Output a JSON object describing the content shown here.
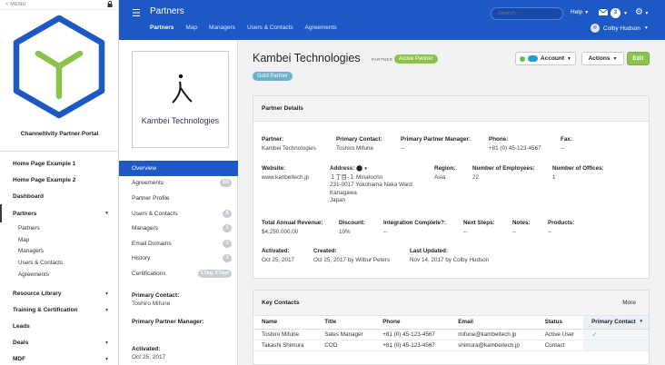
{
  "sidebar": {
    "menu_label": "MENU",
    "portal_name": "Channeltivity Partner Portal",
    "nav": [
      {
        "label": "Home Page Example 1"
      },
      {
        "label": "Home Page Example 2"
      },
      {
        "label": "Dashboard"
      },
      {
        "label": "Partners",
        "sub": [
          "Partners",
          "Map",
          "Managers",
          "Users & Contacts",
          "Agreements"
        ]
      },
      {
        "label": "Resource Library"
      },
      {
        "label": "Training & Certification"
      },
      {
        "label": "Leads"
      },
      {
        "label": "Deals"
      },
      {
        "label": "MDF"
      }
    ]
  },
  "header": {
    "title": "Partners",
    "tabs": [
      "Partners",
      "Map",
      "Managers",
      "Users & Contacts",
      "Agreements"
    ],
    "search_placeholder": "Search...",
    "help_label": "Help",
    "mail_count": "3",
    "user_name": "Colby Hudson"
  },
  "detail_panel": {
    "logo_text": "Kambei Technologies",
    "subnav": [
      {
        "label": "Overview",
        "count": ""
      },
      {
        "label": "Agreements",
        "count": "3/3"
      },
      {
        "label": "Partner Profile",
        "count": ""
      },
      {
        "label": "Users & Contacts",
        "count": "5"
      },
      {
        "label": "Managers",
        "count": "1"
      },
      {
        "label": "Email Domains",
        "count": "1"
      },
      {
        "label": "History",
        "count": "2"
      },
      {
        "label": "Certifications",
        "count": "1 Org, 3 User"
      }
    ],
    "primary_contact_label": "Primary Contact:",
    "primary_contact_value": "Toshiro Mifune",
    "primary_manager_label": "Primary Partner Manager:",
    "primary_manager_value": "",
    "activated_label": "Activated:",
    "activated_value": "Oct 25, 2017"
  },
  "main": {
    "company_name": "Kambei Technologies",
    "partner_tag": "PARTNER",
    "status_badge": "Active Partner",
    "tier_badge": "Gold Partner",
    "buttons": {
      "account": "Account",
      "actions": "Actions",
      "edit": "Edit"
    },
    "details_title": "Partner Details",
    "details": {
      "partner_label": "Partner:",
      "partner_value": "Kambei Technologies",
      "primary_contact_label": "Primary Contact:",
      "primary_contact_value": "Toshiro Mifune",
      "primary_manager_label": "Primary Partner Manager:",
      "primary_manager_value": "--",
      "phone_label": "Phone:",
      "phone_value": "+81 (0) 45-123-4567",
      "fax_label": "Fax:",
      "fax_value": "--",
      "website_label": "Website:",
      "website_value": "www.kanbeitech.jp",
      "address_label": "Address:",
      "address_lines": [
        "１丁目-１ Minatocho",
        "231-0017 Yokohama Naka Ward",
        "Kanagawa",
        "Japan"
      ],
      "region_label": "Region:",
      "region_value": "Asia",
      "employees_label": "Number of Employees:",
      "employees_value": "22",
      "offices_label": "Number of Offices:",
      "offices_value": "1",
      "revenue_label": "Total Annual Revenue:",
      "revenue_value": "$4,250,000.00",
      "discount_label": "Discount:",
      "discount_value": "10%",
      "integration_label": "Integration Complete?:",
      "integration_value": "--",
      "next_steps_label": "Next Steps:",
      "next_steps_value": "--",
      "notes_label": "Notes:",
      "notes_value": "--",
      "products_label": "Products:",
      "products_value": "--",
      "activated_label": "Activated:",
      "activated_value": "Oct 25, 2017",
      "created_label": "Created:",
      "created_value": "Oct 25, 2017 by Wilbur Peters",
      "updated_label": "Last Updated:",
      "updated_value": "Nov 14, 2017 by Colby Hudson"
    },
    "contacts_title": "Key Contacts",
    "more_label": "More",
    "contacts_columns": [
      "Name",
      "Title",
      "Phone",
      "Email",
      "Status",
      "Primary Contact"
    ],
    "contacts_rows": [
      [
        "Toshiro Mifune",
        "Sales Manager",
        "+81 (0) 45-123-4567",
        "mifune@kambeitech.jp",
        "Active User",
        "✓"
      ],
      [
        "Takashi Shimura",
        "COO",
        "+81 (0) 45-123-4567",
        "shimura@kambeitech.jp",
        "Contact",
        ""
      ]
    ]
  },
  "colors": {
    "header_blue": "#1c59c4",
    "logo_blue": "#1c59c4",
    "logo_green": "#8bc34a",
    "active_green": "#8bc34a",
    "gold_blue": "#6cb0cc"
  }
}
